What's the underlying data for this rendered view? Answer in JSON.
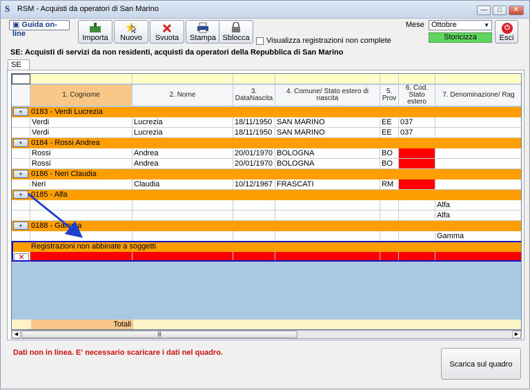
{
  "window": {
    "title": "RSM - Acquisti da operatori di San Marino",
    "icon_letter": "S",
    "minimize": "—",
    "maximize": "□",
    "close": "✕"
  },
  "toolbar": {
    "guida_label": "Guida on-line",
    "importa_label": "Importa",
    "nuovo_label": "Nuovo",
    "svuota_label": "Svuota",
    "stampa_label": "Stampa",
    "sblocca_label": "Sblocca",
    "checkbox_label": "Visualizza registrazioni non complete",
    "checkbox_checked": false,
    "mese_label": "Mese",
    "mese_value": "Ottobre",
    "storicizza_label": "Storicizza",
    "esci_label": "Esci"
  },
  "section_title": "SE: Acquisti di servizi da non residenti, acquisti da operatori della Repubblica di San Marino",
  "tab_label": "SE",
  "grid": {
    "columns": [
      "1. Cognome",
      "2. Nome",
      "3. DataNascita",
      "4. Comune/ Stato estero di nascita",
      "5. Prov",
      "6. Cod. Stato estero",
      "7. Denominazione/ Rag"
    ],
    "groups": [
      {
        "label": "0183 - Verdi Lucrezia",
        "rows": [
          [
            "Verdi",
            "Lucrezia",
            "18/11/1950",
            "SAN MARINO",
            "EE",
            "037",
            ""
          ],
          [
            "Verdi",
            "Lucrezia",
            "18/11/1950",
            "SAN MARINO",
            "EE",
            "037",
            ""
          ]
        ]
      },
      {
        "label": "0184 - Rossi Andrea",
        "rows": [
          [
            "Rossi",
            "Andrea",
            "20/01/1970",
            "BOLOGNA",
            "BO",
            "",
            ""
          ],
          [
            "Rossi",
            "Andrea",
            "20/01/1970",
            "BOLOGNA",
            "BO",
            "",
            ""
          ]
        ]
      },
      {
        "label": "0186 - Neri Claudia",
        "rows": [
          [
            "Neri",
            "Claudia",
            "10/12/1967",
            "FRASCATI",
            "RM",
            "",
            ""
          ]
        ]
      },
      {
        "label": "0185 - Alfa",
        "rows": [
          [
            "",
            "",
            "",
            "",
            "",
            "",
            "Alfa"
          ],
          [
            "",
            "",
            "",
            "",
            "",
            "",
            "Alfa"
          ]
        ]
      },
      {
        "label": "0188 - Gamma",
        "rows": [
          [
            "",
            "",
            "",
            "",
            "",
            "",
            "Gamma"
          ]
        ]
      }
    ],
    "unmatched_label": "Registrazioni non abbinate a soggetti",
    "unmatched_mark": "✕",
    "totals_label": "Totali",
    "expander_glyph": "+",
    "scroll_left": "◀",
    "scroll_right": "▶",
    "scroll_grip": "|||"
  },
  "status_message": "Dati non in linea. E' necessario scaricare i dati nel quadro.",
  "scarica_label": "Scarica sul quadro",
  "colors": {
    "group_orange": "#ff9e00",
    "missing_red": "#ff0000",
    "arrow_blue": "#1f3fd0",
    "storicizza_green": "#5fd75f"
  }
}
